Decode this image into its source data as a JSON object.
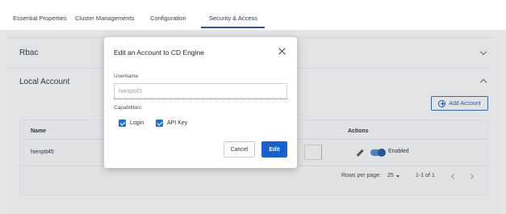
{
  "tabs": [
    {
      "label": "Essential Properties"
    },
    {
      "label": "Cluster Managements"
    },
    {
      "label": "Configuration"
    },
    {
      "label": "Security & Access"
    }
  ],
  "active_tab": "Security & Access",
  "panels": {
    "rbac_title": "Rbac",
    "local_account_title": "Local Account"
  },
  "add_account_label": "Add Account",
  "table": {
    "headers": {
      "name": "Name",
      "actions": "Actions"
    },
    "rows": [
      {
        "name": "hienptt45",
        "status": "Enabled",
        "enabled": true
      }
    ],
    "pagination": {
      "rows_per_page_label": "Rows per page:",
      "rows_per_page_value": "25",
      "range": "1-1 of 1"
    }
  },
  "modal": {
    "title": "Edit an Account to CD Engine",
    "username_label": "Username:",
    "username_value": "hienptt45",
    "capabilities_label": "Capabilities:",
    "capabilities": [
      {
        "label": "Login",
        "checked": true
      },
      {
        "label": "API Key",
        "checked": true
      }
    ],
    "cancel_label": "Cancel",
    "edit_label": "Edit"
  },
  "colors": {
    "primary": "#1660d0",
    "tab_underline": "#1f5ba6",
    "backdrop": "#e9eaec"
  }
}
